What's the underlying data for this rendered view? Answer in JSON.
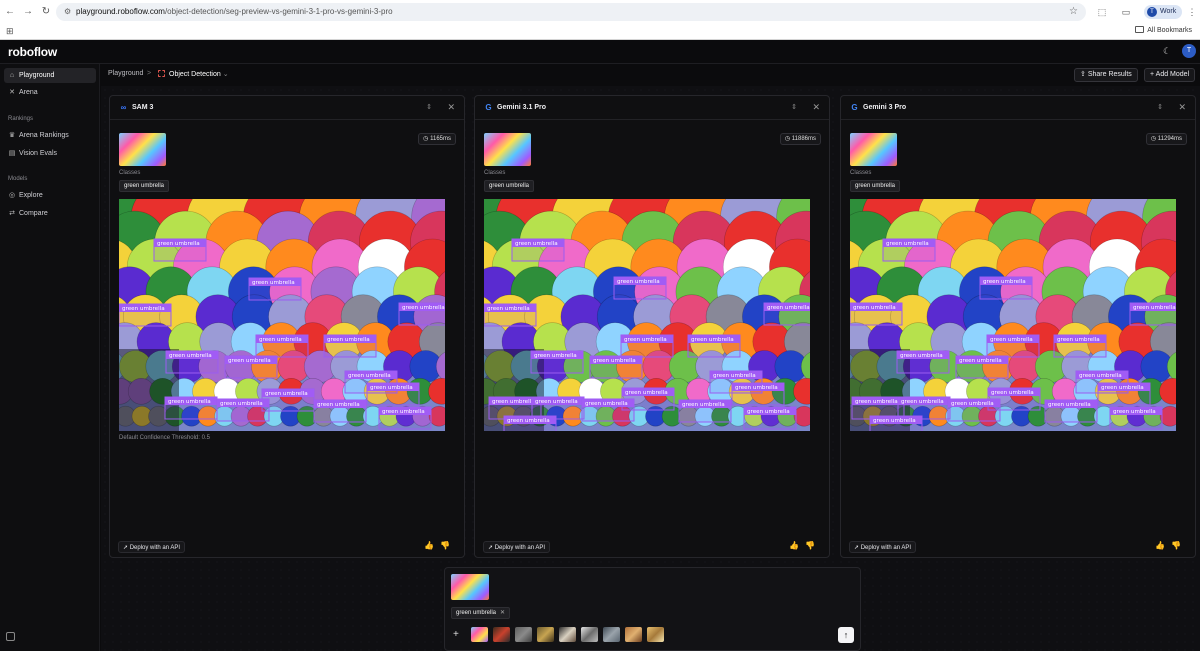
{
  "browser": {
    "url_host": "playground.roboflow.com",
    "url_path": "/object-detection/seg-preview-vs-gemini-3-1-pro-vs-gemini-3-pro",
    "profile_initial": "T",
    "profile_label": "Work",
    "bookmarks_label": "All Bookmarks"
  },
  "app": {
    "logo": "roboflow",
    "user_initial": "T"
  },
  "sidebar": {
    "items_top": [
      {
        "label": "Playground",
        "icon": "playground-icon"
      },
      {
        "label": "Arena",
        "icon": "arena-icon"
      }
    ],
    "rankings_heading": "Rankings",
    "rankings": [
      {
        "label": "Arena Rankings",
        "icon": "rankings-icon"
      },
      {
        "label": "Vision Evals",
        "icon": "evals-icon"
      }
    ],
    "models_heading": "Models",
    "models": [
      {
        "label": "Explore",
        "icon": "explore-icon"
      },
      {
        "label": "Compare",
        "icon": "compare-icon"
      }
    ]
  },
  "breadcrumb": {
    "root": "Playground",
    "separator": ">",
    "current": "Object Detection"
  },
  "toolbar": {
    "share_label": "Share Results",
    "add_model_label": "Add Model"
  },
  "panels": [
    {
      "model": "SAM 3",
      "icon_color": "#3a78ff",
      "latency": "1165ms",
      "classes_label": "Classes",
      "class": "green umbrella",
      "threshold": "Default Confidence Threshold: 0.5",
      "deploy": "Deploy with an API",
      "boxes": [
        [
          35,
          40,
          "green umbrella"
        ],
        [
          130,
          79,
          "green umbrella"
        ],
        [
          0,
          105,
          "green umbrella"
        ],
        [
          280,
          104,
          "green umbrella"
        ],
        [
          137,
          136,
          "green umbrella"
        ],
        [
          205,
          136,
          "green umbrella"
        ],
        [
          47,
          152,
          "green umbrella"
        ],
        [
          106,
          157,
          "green umbrella"
        ],
        [
          226,
          172,
          "green umbrella"
        ],
        [
          248,
          184,
          "green umbrella"
        ],
        [
          143,
          190,
          "green umbrella"
        ],
        [
          46,
          198,
          "green umbrella"
        ],
        [
          98,
          200,
          "green umbrella"
        ],
        [
          195,
          201,
          "green umbrella"
        ],
        [
          260,
          208,
          "green umbrella"
        ]
      ]
    },
    {
      "model": "Gemini 3.1 Pro",
      "icon_color": "#4285f4",
      "latency": "11886ms",
      "classes_label": "Classes",
      "class": "green umbrella",
      "threshold": "",
      "deploy": "Deploy with an API",
      "boxes": [
        [
          28,
          40,
          "green umbrella"
        ],
        [
          130,
          78,
          "green umbrella"
        ],
        [
          0,
          105,
          "green umbrella"
        ],
        [
          280,
          104,
          "green umbrella"
        ],
        [
          137,
          136,
          "green umbrella"
        ],
        [
          204,
          136,
          "green umbrella"
        ],
        [
          47,
          152,
          "green umbrella"
        ],
        [
          106,
          157,
          "green umbrella"
        ],
        [
          226,
          172,
          "green umbrella"
        ],
        [
          248,
          184,
          "green umbrella"
        ],
        [
          138,
          189,
          "green umbrella"
        ],
        [
          5,
          198,
          "green umbrella"
        ],
        [
          48,
          198,
          "green umbrella"
        ],
        [
          98,
          200,
          "green umbrella"
        ],
        [
          195,
          201,
          "green umbrella"
        ],
        [
          260,
          208,
          "green umbrella"
        ],
        [
          20,
          217,
          "green umbrella"
        ]
      ]
    },
    {
      "model": "Gemini 3 Pro",
      "icon_color": "#4285f4",
      "latency": "11294ms",
      "classes_label": "Classes",
      "class": "green umbrella",
      "threshold": "",
      "deploy": "Deploy with an API",
      "boxes": [
        [
          33,
          40,
          "green umbrella"
        ],
        [
          130,
          78,
          "green umbrella"
        ],
        [
          0,
          104,
          "green umbrella"
        ],
        [
          280,
          104,
          "green umbrella"
        ],
        [
          137,
          136,
          "green umbrella"
        ],
        [
          204,
          136,
          "green umbrella"
        ],
        [
          47,
          152,
          "green umbrella"
        ],
        [
          106,
          157,
          "green umbrella"
        ],
        [
          226,
          172,
          "green umbrella"
        ],
        [
          248,
          184,
          "green umbrella"
        ],
        [
          138,
          189,
          "green umbrella"
        ],
        [
          2,
          198,
          "green umbrella"
        ],
        [
          48,
          198,
          "green umbrella"
        ],
        [
          98,
          200,
          "green umbrella"
        ],
        [
          195,
          201,
          "green umbrella"
        ],
        [
          260,
          208,
          "green umbrella"
        ],
        [
          20,
          217,
          "green umbrella"
        ]
      ]
    }
  ],
  "composer": {
    "chip_label": "green umbrella",
    "add_label": "+",
    "send_label": "↑"
  }
}
